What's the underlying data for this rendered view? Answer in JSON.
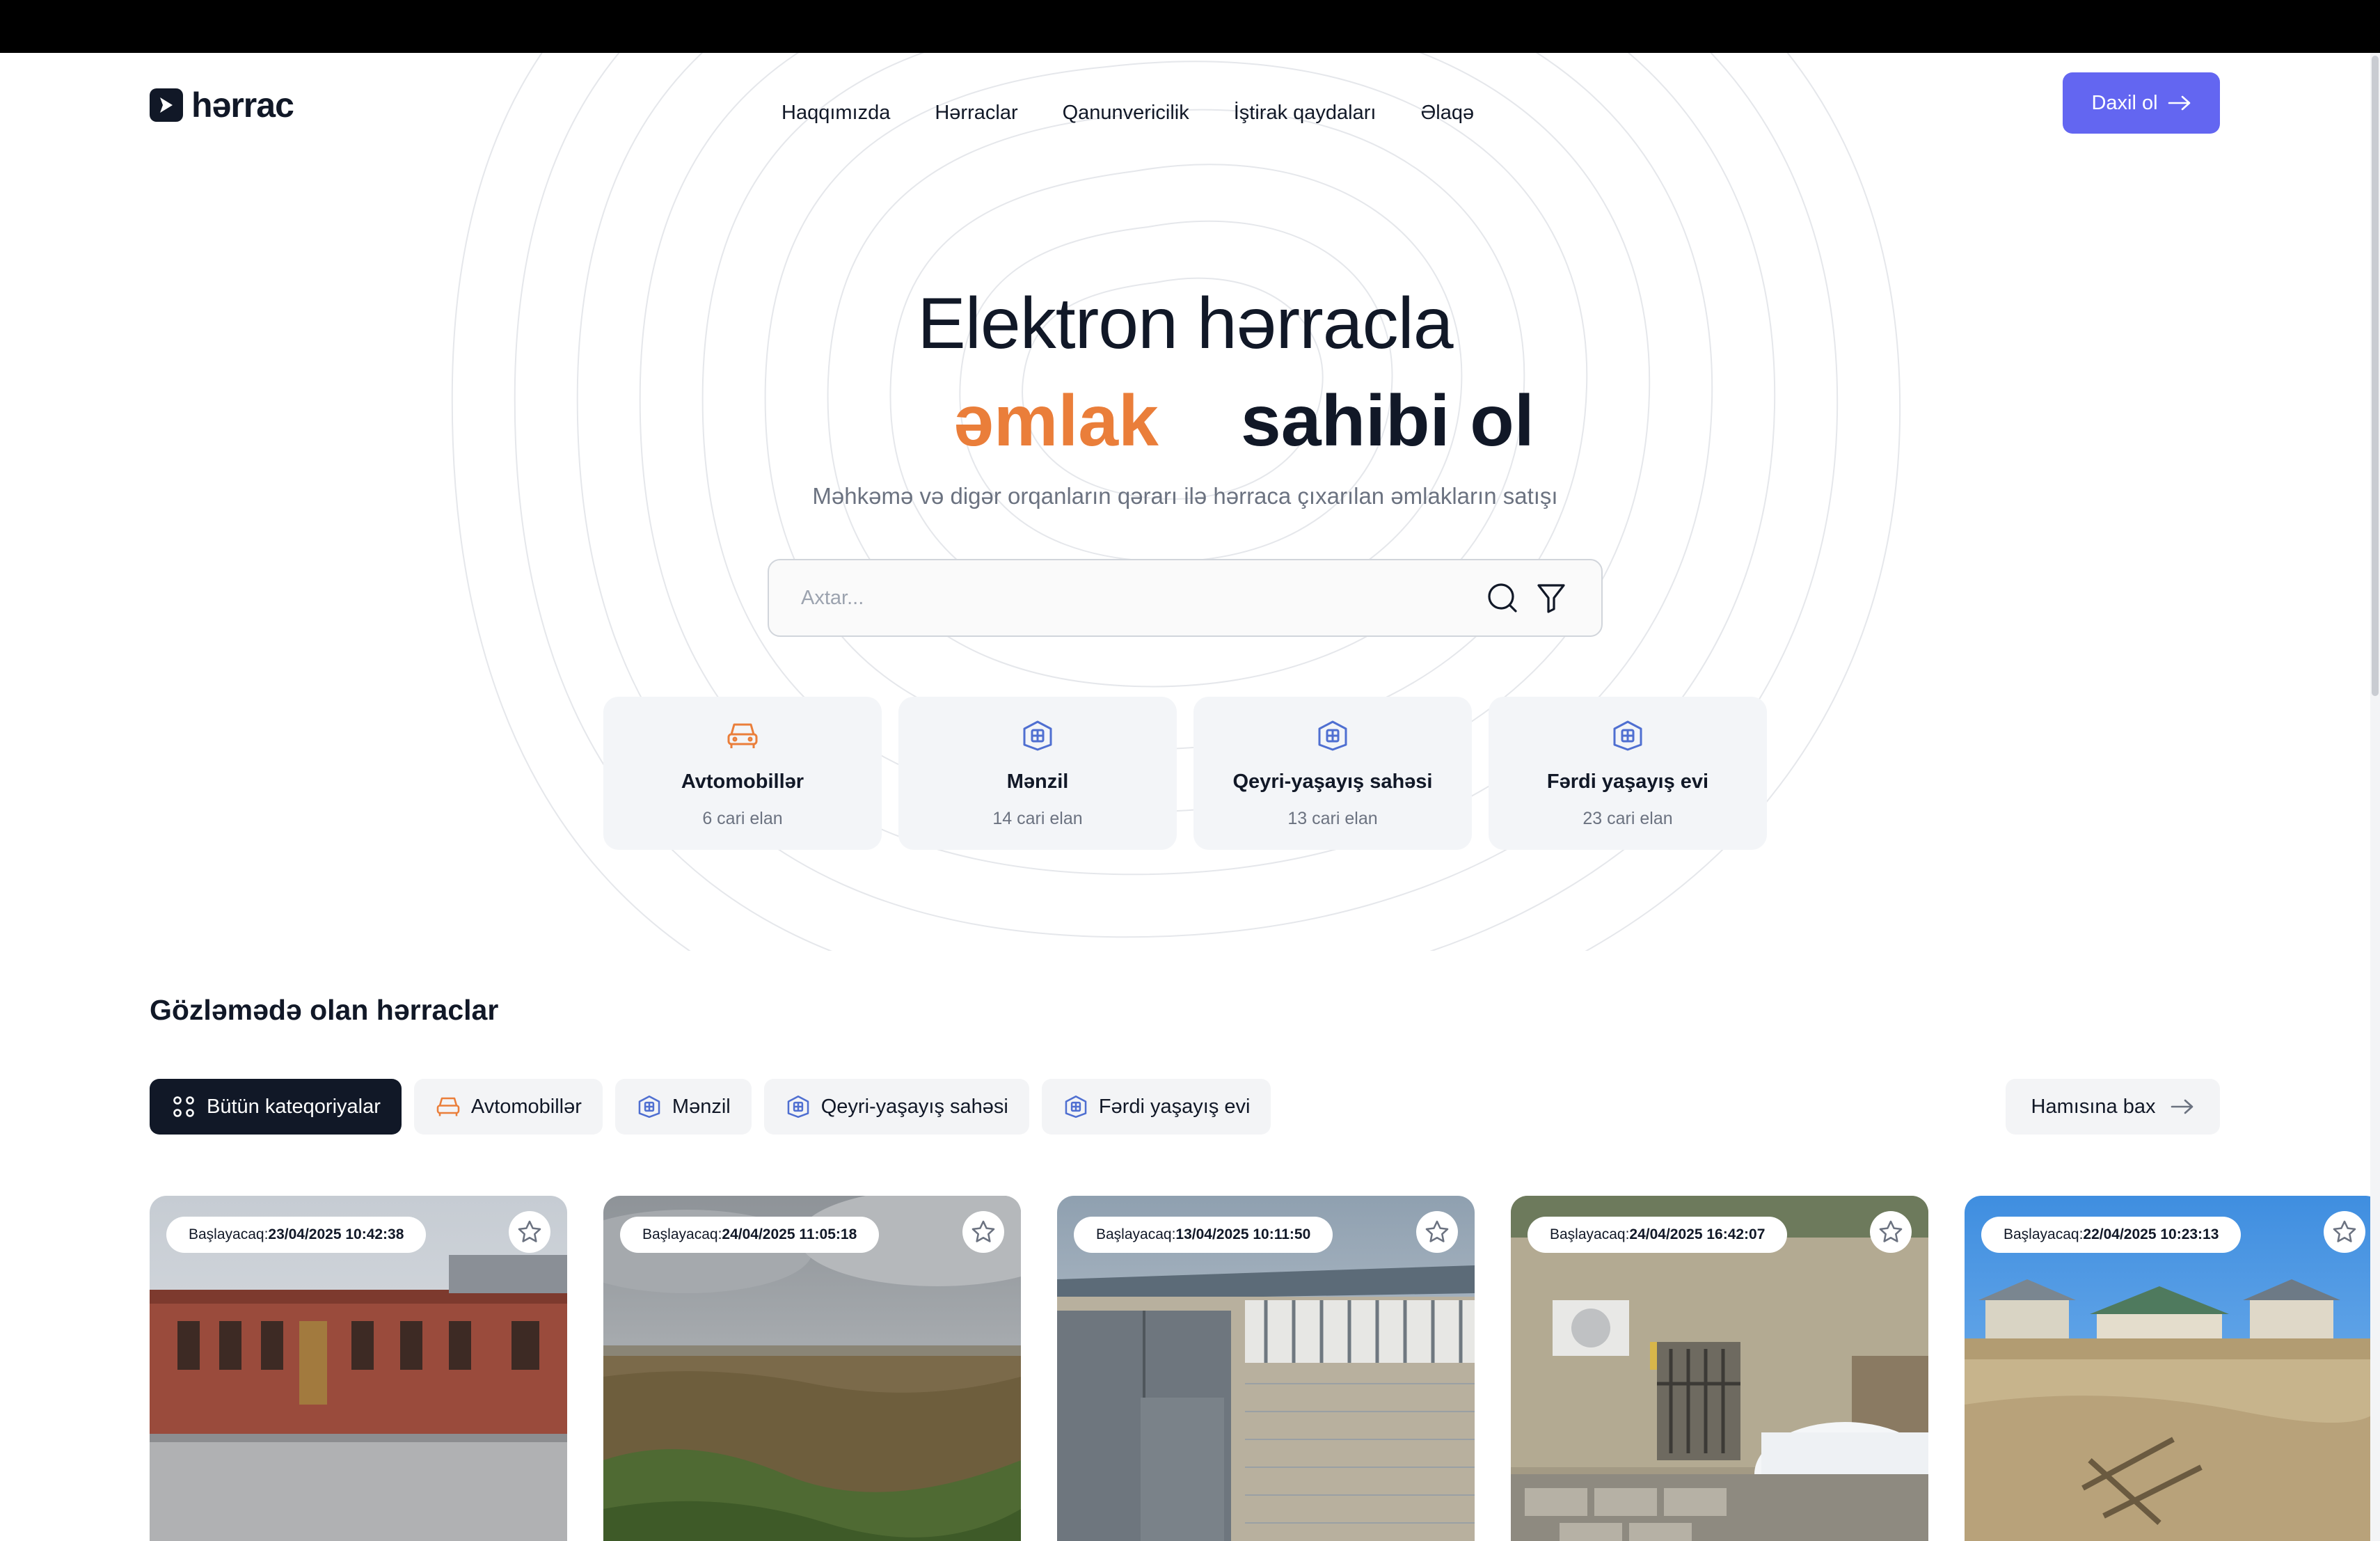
{
  "brand": {
    "name": "hərrac"
  },
  "nav": [
    {
      "label": "Haqqımızda"
    },
    {
      "label": "Hərraclar"
    },
    {
      "label": "Qanunvericilik"
    },
    {
      "label": "İştirak qaydaları"
    },
    {
      "label": "Əlaqə"
    }
  ],
  "header": {
    "login_label": "Daxil ol"
  },
  "hero": {
    "title": "Elektron hərracla",
    "accent": "əmlak",
    "title_end": "sahibi ol",
    "subtitle": "Məhkəmə və digər orqanların qərarı ilə hərraca çıxarılan əmlakların satışı"
  },
  "search": {
    "placeholder": "Axtar...",
    "value": ""
  },
  "categories": [
    {
      "name": "Avtomobillər",
      "count": "6 cari elan",
      "icon": "car-icon"
    },
    {
      "name": "Mənzil",
      "count": "14 cari elan",
      "icon": "building-icon"
    },
    {
      "name": "Qeyri-yaşayış sahəsi",
      "count": "13 cari elan",
      "icon": "building-icon"
    },
    {
      "name": "Fərdi yaşayış evi",
      "count": "23 cari elan",
      "icon": "building-icon"
    }
  ],
  "pending": {
    "title": "Gözləmədə olan hərraclar",
    "see_all": "Hamısına bax",
    "filters": [
      {
        "label": "Bütün kateqoriyalar",
        "icon": "grid-dots-icon",
        "active": true
      },
      {
        "label": "Avtomobillər",
        "icon": "car-icon",
        "active": false
      },
      {
        "label": "Mənzil",
        "icon": "building-icon",
        "active": false
      },
      {
        "label": "Qeyri-yaşayış sahəsi",
        "icon": "building-icon",
        "active": false
      },
      {
        "label": "Fərdi yaşayış evi",
        "icon": "building-icon",
        "active": false
      }
    ],
    "badge_prefix": "Başlayacaq:",
    "lots": [
      {
        "start": "23/04/2025 10:42:38",
        "photo": "brick-building-photo"
      },
      {
        "start": "24/04/2025 11:05:18",
        "photo": "field-land-photo"
      },
      {
        "start": "13/04/2025 10:11:50",
        "photo": "house-gate-photo"
      },
      {
        "start": "24/04/2025 16:42:07",
        "photo": "yard-water-tank-photo"
      },
      {
        "start": "22/04/2025 10:23:13",
        "photo": "construction-site-photo"
      }
    ]
  },
  "colors": {
    "accent": "#6366f1",
    "orange": "#ea7e3a",
    "dark": "#111827",
    "muted": "#6b7280",
    "icon_blue": "#4f6fd1"
  }
}
